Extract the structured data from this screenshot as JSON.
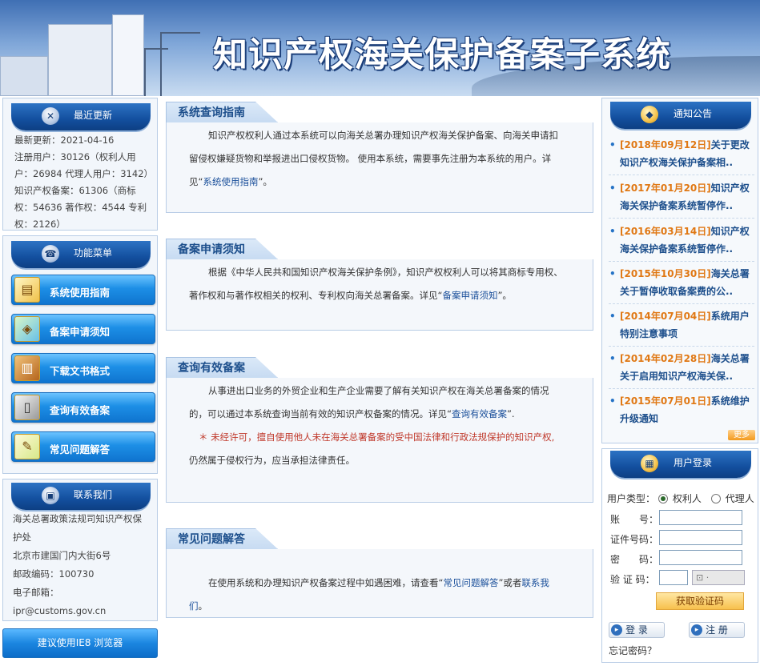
{
  "banner": {
    "title": "知识产权海关保护备案子系统"
  },
  "recent": {
    "title": "最近更新",
    "icon": "tools-icon",
    "lines": [
      "最新更新：2021-04-16",
      "注册用户：30126（权利人用",
      "户：26984 代理人用户：3142）",
      "知识产权备案：61306（商标",
      "权：54636 著作权：4544 专利",
      "权：2126）"
    ]
  },
  "menu": {
    "title": "功能菜单",
    "icon": "phone-icon",
    "items": [
      {
        "label": "系统使用指南",
        "icon": "folder-icon"
      },
      {
        "label": "备案申请须知",
        "icon": "map-icon"
      },
      {
        "label": "下载文书格式",
        "icon": "book-icon"
      },
      {
        "label": "查询有效备案",
        "icon": "door-icon"
      },
      {
        "label": "常见问题解答",
        "icon": "pen-icon"
      }
    ]
  },
  "contact": {
    "title": "联系我们",
    "icon": "printer-icon",
    "lines": [
      "海关总署政策法规司知识产权保",
      "护处",
      "北京市建国门内大街6号",
      "邮政编码：100730",
      "电子邮箱：",
      "ipr@customs.gov.cn"
    ]
  },
  "ie_notice": "建议使用IE8 浏览器",
  "sections": [
    {
      "title": "系统查询指南",
      "lines": [
        "知识产权权利人通过本系统可以向海关总署办理知识产权海关保护备案、向海关申",
        "请扣留侵权嫌疑货物和举报进出口侵权货物。 使用本系统，需要事先注册为本系统的用",
        "户。详见“",
        "系统使用指南",
        "”。"
      ]
    },
    {
      "title": "备案申请须知",
      "lines": [
        "根据《中华人民共和国知识产权海关保护条例》，知识产权权利人可以将其商标专",
        "用权、著作权和与著作权相关的权利、专利权向海关总署备案。详见“",
        "备案申请须知",
        "”。"
      ]
    },
    {
      "title": "查询有效备案",
      "lines": [
        "从事进出口业务的外贸企业和生产企业需要了解有关知识产权在海关总署备案的情",
        "况的，可以通过本系统查询当前有效的知识产权备案的情况。详见“",
        "查询有效备案",
        "”.",
        "＊ 未经许可，擅自使用他人未在海关总署备案的受中国法律和行政法规保护的知识产权,",
        "仍然属于侵权行为，应当承担法律责任。"
      ]
    },
    {
      "title": "常见问题解答",
      "lines": [
        "在使用系统和办理知识产权备案过程中如遇困难，请查看“",
        "常见问题解答",
        "”或者",
        "联系我们",
        "。"
      ]
    }
  ],
  "notices": {
    "title": "通知公告",
    "icon": "bell-icon",
    "more": "更多",
    "items": [
      {
        "date": "[2018年09月12日]",
        "text": "关于更改",
        "text2": "知识产权海关保护备案相.."
      },
      {
        "date": "[2017年01月20日]",
        "text": "知识产权",
        "text2": "海关保护备案系统暂停作.."
      },
      {
        "date": "[2016年03月14日]",
        "text": "知识产权",
        "text2": "海关保护备案系统暂停作.."
      },
      {
        "date": "[2015年10月30日]",
        "text": "海关总署",
        "text2": "关于暂停收取备案费的公.."
      },
      {
        "date": "[2014年07月04日]",
        "text": "系统用户",
        "text2": "特别注意事项"
      },
      {
        "date": "[2014年02月28日]",
        "text": "海关总署",
        "text2": "关于启用知识产权海关保.."
      },
      {
        "date": "[2015年07月01日]",
        "text": "系统维护",
        "text2": "升级通知"
      }
    ]
  },
  "login": {
    "title": "用户登录",
    "icon": "calendar-icon",
    "user_type_label": "用户类型：",
    "type_owner": "权利人",
    "type_agent": "代理人",
    "account_label": "账　　号：",
    "cert_label": "证件号码：",
    "password_label": "密　　码：",
    "code_label": "验 证 码：",
    "get_code": "获取验证码",
    "login_btn": "登 录",
    "register_btn": "注 册",
    "forgot": "忘记密码？"
  }
}
